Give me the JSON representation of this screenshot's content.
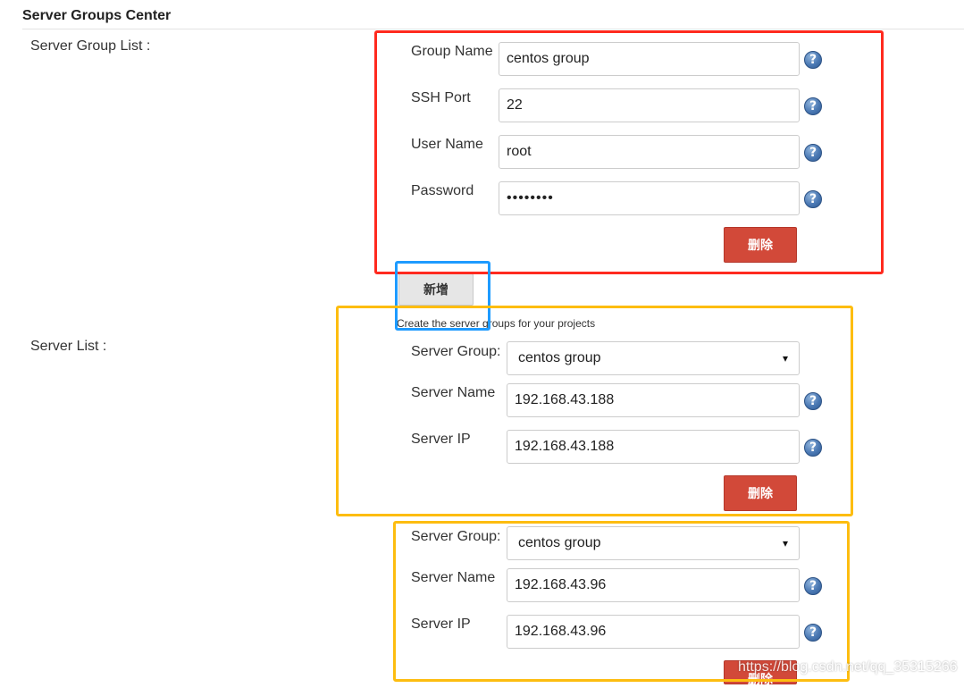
{
  "header": {
    "title": "Server Groups Center"
  },
  "left_labels": {
    "server_group_list": "Server Group List :",
    "server_list": "Server List :"
  },
  "group_form": {
    "group_name_label": "Group Name",
    "group_name_value": "centos group",
    "ssh_port_label": "SSH Port",
    "ssh_port_value": "22",
    "user_name_label": "User Name",
    "user_name_value": "root",
    "password_label": "Password",
    "password_value": "••••••••",
    "delete_label": "删除"
  },
  "add_button": {
    "label": "新增"
  },
  "hint": "Create the server groups for your projects",
  "servers": [
    {
      "group_label": "Server Group:",
      "group_value": "centos group",
      "name_label": "Server Name",
      "name_value": "192.168.43.188",
      "ip_label": "Server IP",
      "ip_value": "192.168.43.188",
      "delete_label": "删除"
    },
    {
      "group_label": "Server Group:",
      "group_value": "centos group",
      "name_label": "Server Name",
      "name_value": "192.168.43.96",
      "ip_label": "Server IP",
      "ip_value": "192.168.43.96",
      "delete_label": "删除"
    }
  ],
  "help_icon_glyph": "?",
  "select_caret_glyph": "▾",
  "watermark": "https://blog.csdn.net/qq_35315266",
  "colors": {
    "red_box": "#ff2a1f",
    "blue_box": "#1e9bff",
    "yellow_box": "#fdbd10",
    "delete_button": "#d24939",
    "help_icon": "#4b79b4"
  }
}
